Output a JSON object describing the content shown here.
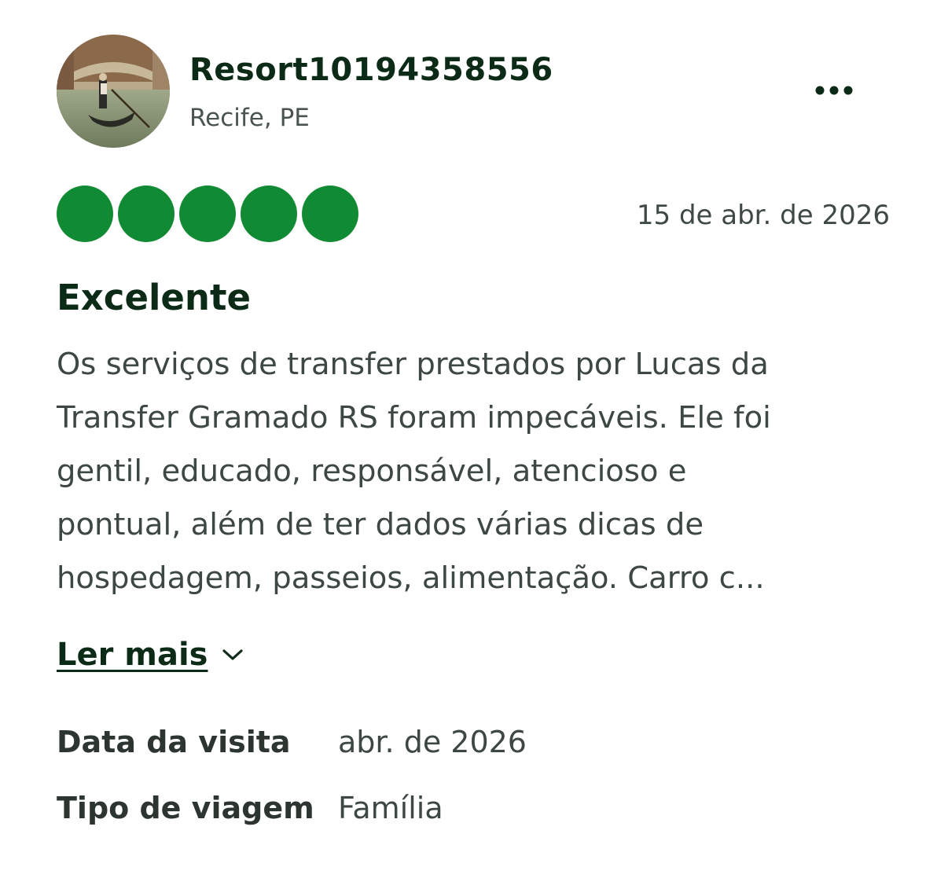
{
  "reviewer": {
    "name": "Resort10194358556",
    "location": "Recife, PE",
    "avatar_icon": "gondola-photo-avatar"
  },
  "menu": {
    "icon": "more-horizontal-icon"
  },
  "rating": {
    "value": 5,
    "max": 5,
    "color": "#118a34"
  },
  "review": {
    "date": "15 de abr. de 2026",
    "title": "Excelente",
    "body_lines": [
      "Os serviços de transfer prestados por Lucas da",
      "Transfer Gramado RS foram impecáveis. Ele foi",
      "gentil, educado, responsável, atencioso e",
      "pontual, além de ter dados várias dicas de",
      "hospedagem, passeios, alimentação. Carro c..."
    ],
    "read_more_label": "Ler mais",
    "read_more_icon": "chevron-down-icon"
  },
  "details": {
    "visit_date_label": "Data da visita",
    "visit_date_value": "abr. de 2026",
    "trip_type_label": "Tipo de viagem",
    "trip_type_value": "Família"
  }
}
